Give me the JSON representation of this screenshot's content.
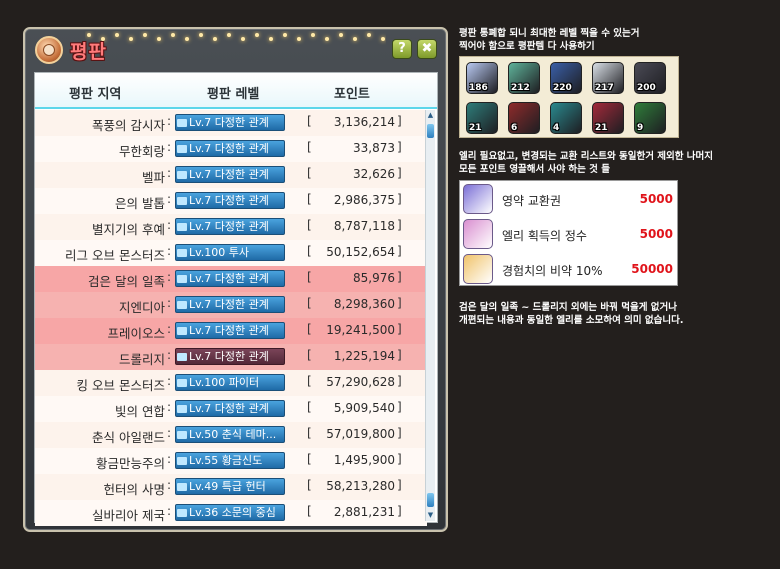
{
  "window": {
    "title": "평판",
    "help_label": "?",
    "close_label": "✖",
    "icon": "reputation-medal-icon"
  },
  "table": {
    "headers": {
      "region": "평판 지역",
      "level": "평판 레벨",
      "points": "포인트"
    },
    "rows": [
      {
        "region": "폭풍의 감시자",
        "level": "Lv.7 다정한 관계",
        "points": "3,136,214",
        "highlight": false
      },
      {
        "region": "무한회랑",
        "level": "Lv.7 다정한 관계",
        "points": "33,873",
        "highlight": false
      },
      {
        "region": "벨파",
        "level": "Lv.7 다정한 관계",
        "points": "32,626",
        "highlight": false
      },
      {
        "region": "은의 발톱",
        "level": "Lv.7 다정한 관계",
        "points": "2,986,375",
        "highlight": false
      },
      {
        "region": "별지기의 후예",
        "level": "Lv.7 다정한 관계",
        "points": "8,787,118",
        "highlight": false
      },
      {
        "region": "리그 오브 몬스터즈",
        "level": "Lv.100 투사",
        "points": "50,152,654",
        "highlight": false
      },
      {
        "region": "검은 달의 일족",
        "level": "Lv.7 다정한 관계",
        "points": "85,976",
        "highlight": true
      },
      {
        "region": "지엔디아",
        "level": "Lv.7 다정한 관계",
        "points": "8,298,360",
        "highlight": true
      },
      {
        "region": "프레이오스",
        "level": "Lv.7 다정한 관계",
        "points": "19,241,500",
        "highlight": true
      },
      {
        "region": "드롤리지",
        "level": "Lv.7 다정한 관계",
        "points": "1,225,194",
        "highlight": true,
        "dark": true
      },
      {
        "region": "킹 오브 몬스터즈",
        "level": "Lv.100 파이터",
        "points": "57,290,628",
        "highlight": false
      },
      {
        "region": "빛의 연합",
        "level": "Lv.7 다정한 관계",
        "points": "5,909,540",
        "highlight": false
      },
      {
        "region": "춘식 아일랜드",
        "level": "Lv.50 춘식 테마...",
        "points": "57,019,800",
        "highlight": false
      },
      {
        "region": "황금만능주의",
        "level": "Lv.55 황금신도",
        "points": "1,495,900",
        "highlight": false
      },
      {
        "region": "헌터의 사명",
        "level": "Lv.49 특급 헌터",
        "points": "58,213,280",
        "highlight": false
      },
      {
        "region": "실바리아 제국",
        "level": "Lv.36 소문의 중심",
        "points": "2,881,231",
        "highlight": false
      }
    ],
    "colon": ":",
    "bracket_open": "[",
    "bracket_close": "]"
  },
  "notes": {
    "note1_line1": "평판 통폐합 되니 최대한 레벨 찍을 수 있는거",
    "note1_line2": "찍어야 함으로 평판템 다 사용하기",
    "note2_line1": "엘리 필요없고, 변경되는 교환 리스트와 동일한거 제외한 나머지",
    "note2_line2": "모든 포인트 영끌해서 사야 하는 것 들",
    "note3_line1": "검은 달의 일족 ~ 드롤리지 외에는 바꿔 먹을게 없거나",
    "note3_line2": "개편되는 내용과 동일한 엘리를 소모하여 의미 없습니다."
  },
  "items": [
    {
      "icon": "scroll-bundle-icon",
      "count": "186",
      "color": "#b9c9f2"
    },
    {
      "icon": "green-token-icon",
      "count": "212",
      "color": "#5fb39a"
    },
    {
      "icon": "blue-feather-icon",
      "count": "220",
      "color": "#3a5fa8"
    },
    {
      "icon": "paper-scroll-icon",
      "count": "217",
      "color": "#d9dfe6"
    },
    {
      "icon": "dark-box-icon",
      "count": "200",
      "color": "#4a4a55"
    },
    {
      "icon": "teal-chest-icon",
      "count": "21",
      "color": "#2e7d7a"
    },
    {
      "icon": "red-chest-icon",
      "count": "6",
      "color": "#8f2b2b"
    },
    {
      "icon": "cyan-chest-icon",
      "count": "4",
      "color": "#2a8a8f"
    },
    {
      "icon": "crimson-chest-icon",
      "count": "21",
      "color": "#a32a3a"
    },
    {
      "icon": "green-chest-icon",
      "count": "9",
      "color": "#2f7d3a"
    }
  ],
  "shop": [
    {
      "icon": "contract-voucher-icon",
      "name": "영약 교환권",
      "price": "5000",
      "color": "#7b6fd6"
    },
    {
      "icon": "ely-essence-icon",
      "name": "엘리 획득의 정수",
      "price": "5000",
      "color": "#d98fd0"
    },
    {
      "icon": "exp-potion-icon",
      "name": "경험치의 비약 10%",
      "price": "50000",
      "color": "#f0c36a"
    }
  ]
}
